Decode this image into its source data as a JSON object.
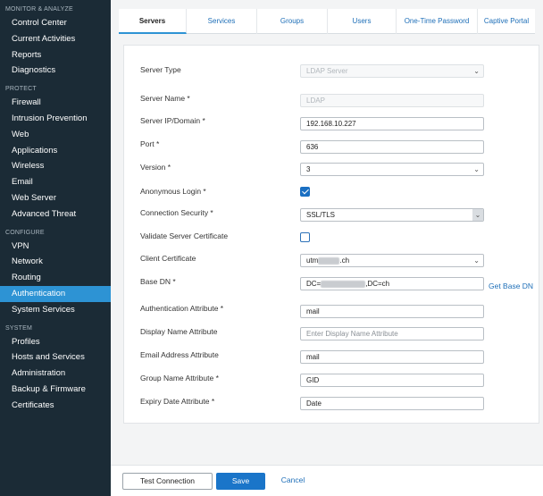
{
  "sidebar": {
    "sections": [
      {
        "title": "MONITOR & ANALYZE",
        "items": [
          "Control Center",
          "Current Activities",
          "Reports",
          "Diagnostics"
        ]
      },
      {
        "title": "PROTECT",
        "items": [
          "Firewall",
          "Intrusion Prevention",
          "Web",
          "Applications",
          "Wireless",
          "Email",
          "Web Server",
          "Advanced Threat"
        ]
      },
      {
        "title": "CONFIGURE",
        "items": [
          "VPN",
          "Network",
          "Routing",
          "Authentication",
          "System Services"
        ]
      },
      {
        "title": "SYSTEM",
        "items": [
          "Profiles",
          "Hosts and Services",
          "Administration",
          "Backup & Firmware",
          "Certificates"
        ]
      }
    ],
    "active_item": "Authentication"
  },
  "tabs": [
    "Servers",
    "Services",
    "Groups",
    "Users",
    "One-Time Password",
    "Captive Portal"
  ],
  "active_tab": "Servers",
  "form": {
    "server_type": {
      "label": "Server Type",
      "value": "LDAP Server"
    },
    "server_name": {
      "label": "Server Name *",
      "value": "LDAP"
    },
    "server_ip": {
      "label": "Server IP/Domain *",
      "value": "192.168.10.227"
    },
    "port": {
      "label": "Port *",
      "value": "636"
    },
    "version": {
      "label": "Version *",
      "value": "3"
    },
    "anonymous_login": {
      "label": "Anonymous Login *",
      "checked": true
    },
    "connection_security": {
      "label": "Connection Security *",
      "value": "SSL/TLS"
    },
    "validate_cert": {
      "label": "Validate Server Certificate",
      "checked": false
    },
    "client_certificate": {
      "label": "Client Certificate",
      "value_prefix": "utm",
      "value_suffix": ".ch"
    },
    "base_dn": {
      "label": "Base DN *",
      "value_prefix": "DC=",
      "value_suffix": ",DC=ch",
      "action": "Get Base DN"
    },
    "auth_attribute": {
      "label": "Authentication Attribute *",
      "value": "mail"
    },
    "display_name_attribute": {
      "label": "Display Name Attribute",
      "placeholder": "Enter Display Name Attribute"
    },
    "email_attribute": {
      "label": "Email Address Attribute",
      "value": "mail"
    },
    "group_name_attribute": {
      "label": "Group Name Attribute *",
      "value": "GID"
    },
    "expiry_date_attribute": {
      "label": "Expiry Date Attribute *",
      "value": "Date"
    }
  },
  "footer": {
    "test_connection": "Test Connection",
    "save": "Save",
    "cancel": "Cancel"
  },
  "icons": {
    "dropdown": "chevron-down-icon",
    "checkbox_checked": "checkmark-icon"
  },
  "colors": {
    "sidebar_bg": "#1b2b36",
    "accent": "#2d93d4",
    "primary_button": "#1a75c9",
    "link": "#1e6fb8"
  }
}
